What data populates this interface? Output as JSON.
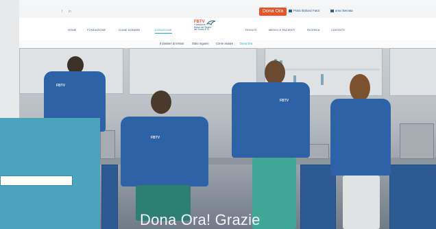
{
  "topbar": {
    "social": [
      "f",
      "in"
    ],
    "donate_label": "Dona Ora",
    "links": [
      "Pratici Bohanz Fanzi",
      "area riservata"
    ]
  },
  "nav": {
    "left": [
      "HOME",
      "FONDAZIONE",
      "COME DONARE",
      "DONAZIONE"
    ],
    "active_index": 3,
    "right": [
      "TESSUTI",
      "MEDICI E PAZIENTI",
      "RICERCA",
      "CONTATTI"
    ]
  },
  "logo": {
    "abbr": "FBTV",
    "lines": [
      "Fondazione",
      "Banca dei Tessuti",
      "del Veneto ETS"
    ]
  },
  "subnav": {
    "items": [
      "Il dossieri di tessuti",
      "Stato inganni",
      "Come aiutare",
      "Dona Ora"
    ],
    "accent_index": 3
  },
  "hero": {
    "caption": "Dona Ora! Grazie",
    "jacket_text": "FBTV"
  },
  "colors": {
    "accent_orange": "#e8542a",
    "accent_teal": "#2aa5c4",
    "jacket_blue": "#2e62a6",
    "panel_teal": "#4aa4bc"
  }
}
